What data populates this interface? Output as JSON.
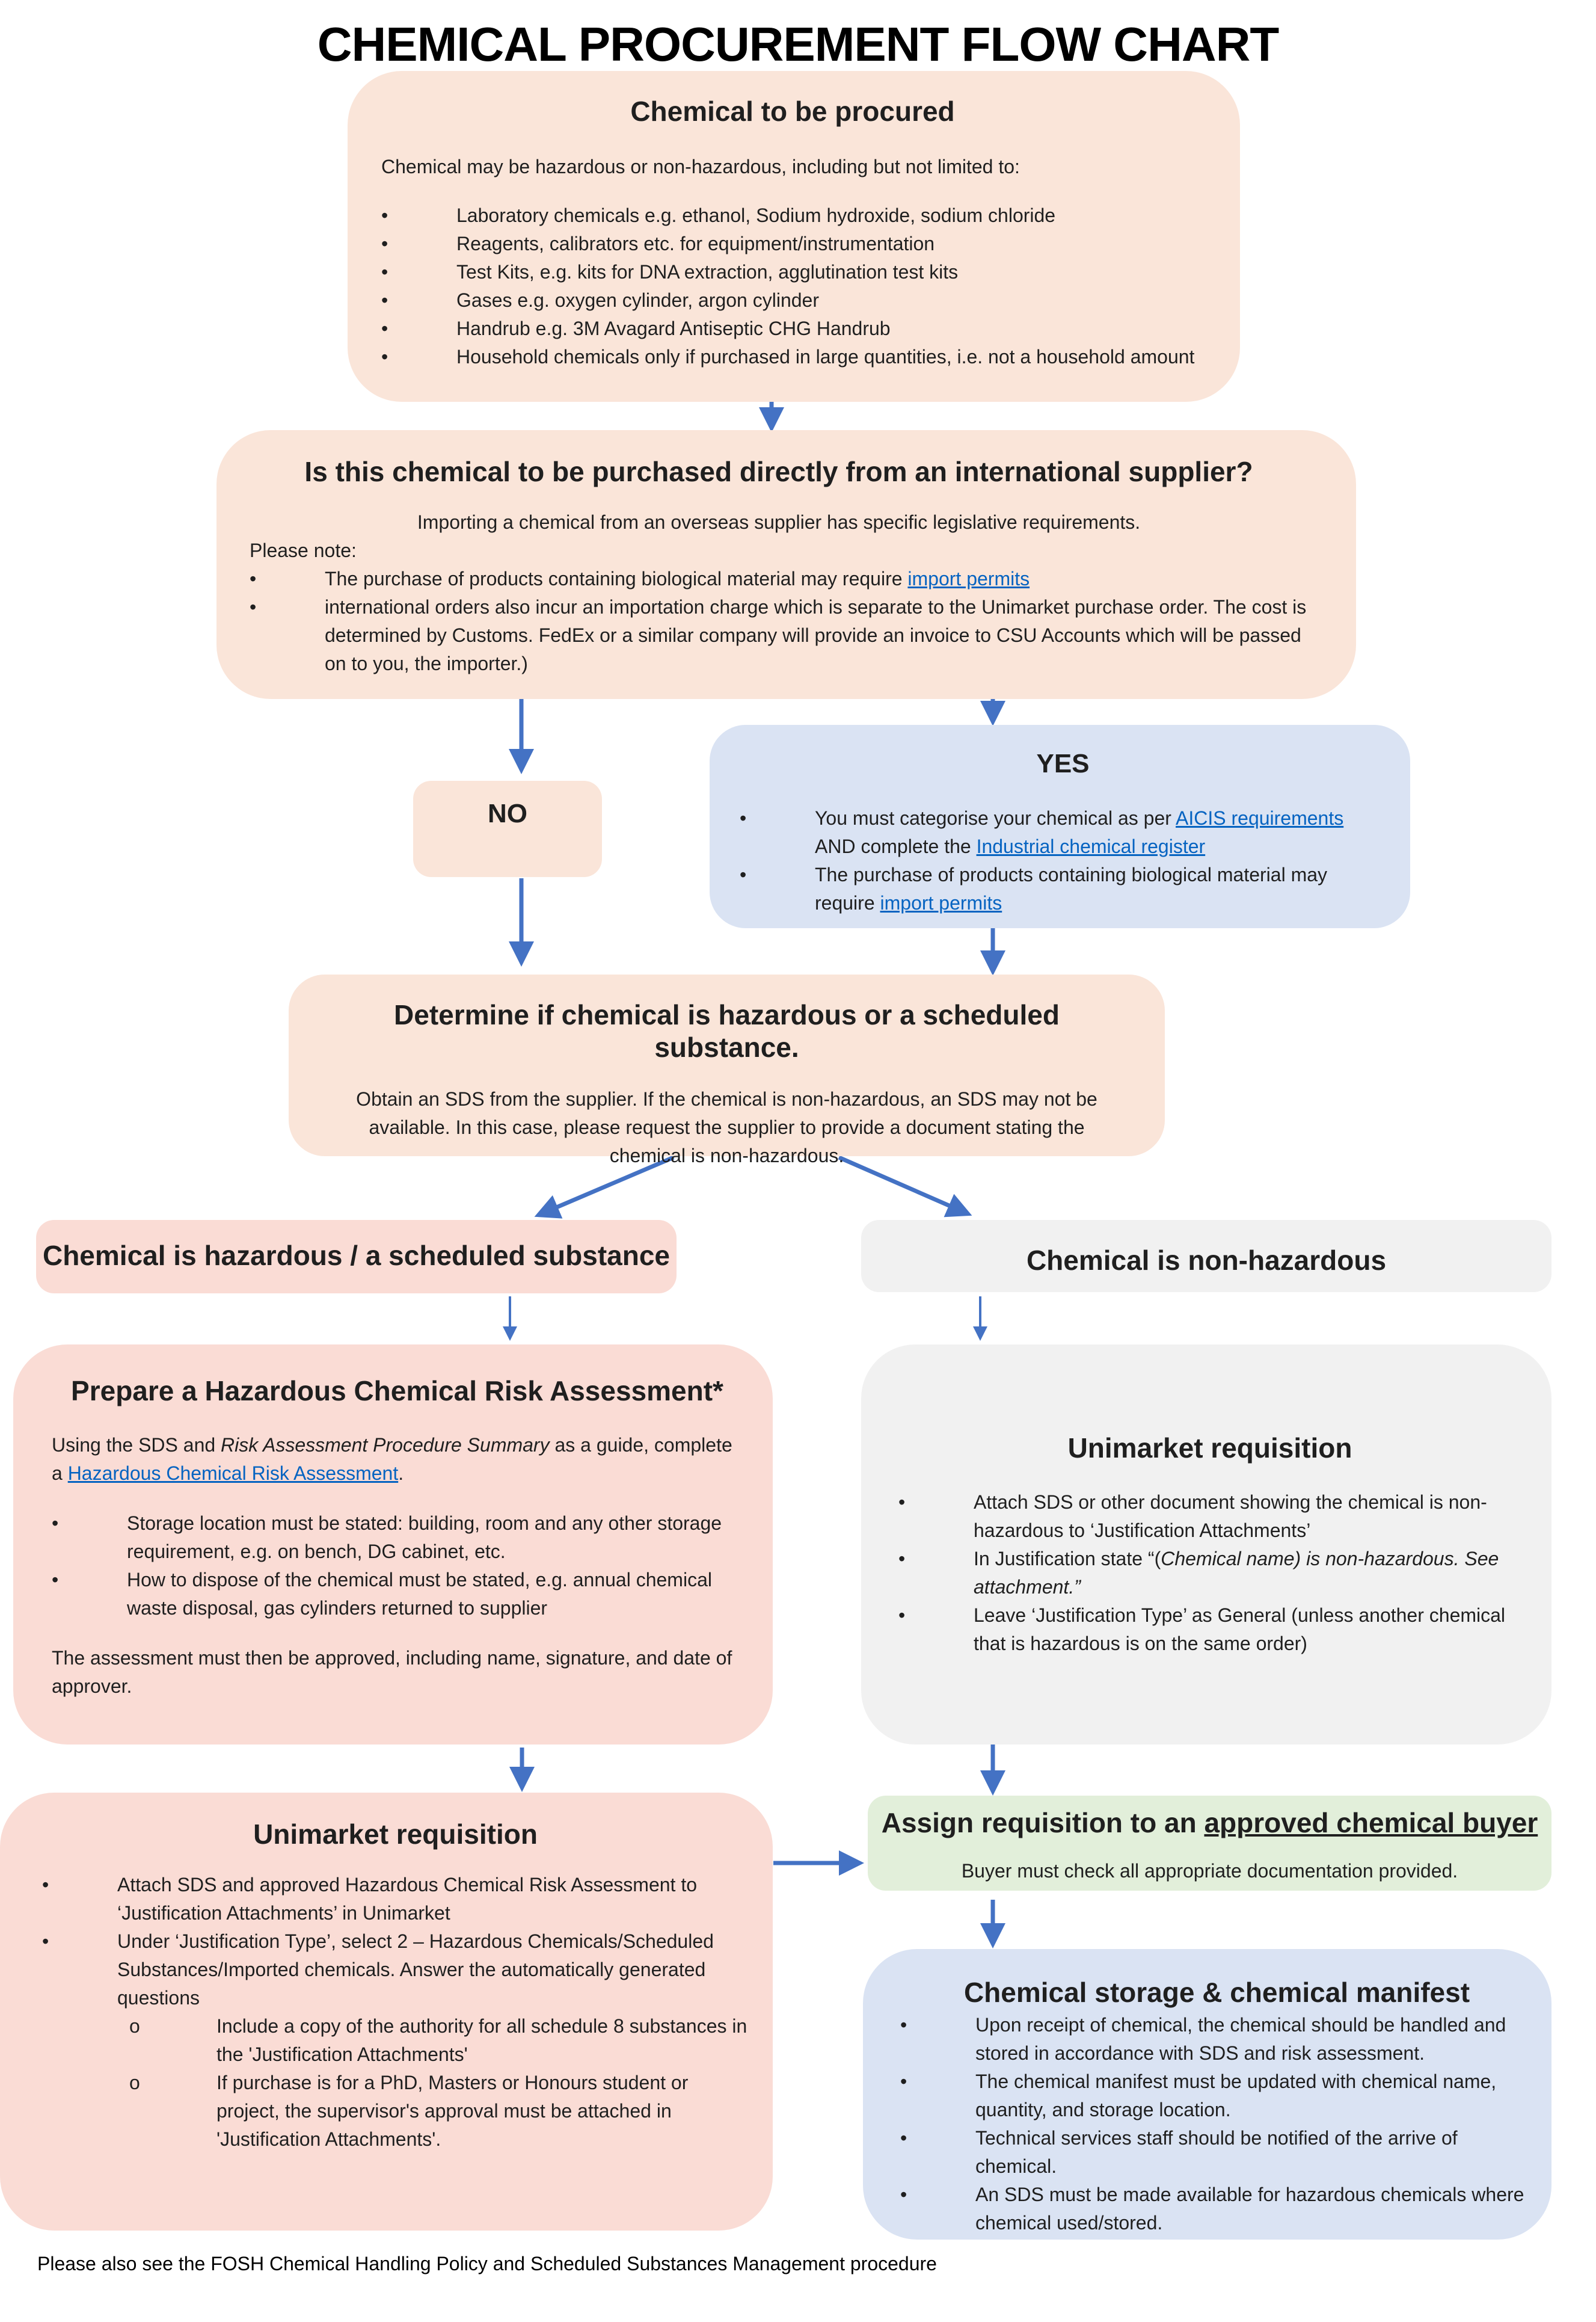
{
  "title": "CHEMICAL PROCUREMENT FLOW CHART",
  "colors": {
    "arrow": "#4472c4",
    "peach": "#fae5d9",
    "pink": "#fadcd5",
    "blue": "#dae3f3",
    "grey": "#f1f1f1",
    "green": "#e2efda",
    "link": "#0563c1"
  },
  "procured": {
    "heading": "Chemical to be procured",
    "intro": "Chemical may be hazardous or non-hazardous, including but not limited to:",
    "items": [
      "Laboratory chemicals e.g. ethanol, Sodium hydroxide, sodium chloride",
      "Reagents, calibrators etc. for equipment/instrumentation",
      "Test Kits, e.g. kits for DNA extraction, agglutination test kits",
      "Gases e.g. oxygen cylinder, argon cylinder",
      "Handrub e.g. 3M Avagard Antiseptic CHG Handrub",
      "Household chemicals only if purchased in large quantities, i.e. not a household amount"
    ]
  },
  "international": {
    "heading": "Is this chemical to be purchased directly from an international supplier?",
    "intro": "Importing a chemical from an overseas supplier has specific  legislative requirements.",
    "note_label": "Please note:",
    "item1_text": "The purchase of  products containing biological material may require ",
    "item1_link": "import permits",
    "item2_text": " international orders also incur an importation charge which is separate to the Unimarket purchase order. The cost is determined by Customs. FedEx or a similar company will provide an invoice to CSU Accounts which will be passed on to you, the importer.)"
  },
  "no_box": {
    "label": "NO"
  },
  "yes_box": {
    "heading": "YES",
    "item1_text": "You must categorise your chemical as per ",
    "item1_link": "AICIS requirements",
    "item1_text2": " AND  complete the ",
    "item1_link2": "Industrial chemical register",
    "item2_text": "The purchase of  products containing biological material may require ",
    "item2_link": "import permits"
  },
  "determine": {
    "heading": "Determine if chemical is hazardous or a scheduled substance.",
    "body": "Obtain an SDS from the supplier. If the chemical is non-hazardous, an SDS may not be available. In this case, please request the supplier to provide a document stating the chemical is non-hazardous."
  },
  "hazardous_label": "Chemical is hazardous / a scheduled substance",
  "nonhazardous_label": "Chemical is non-hazardous",
  "risk_assessment": {
    "heading": "Prepare a Hazardous Chemical Risk Assessment*",
    "intro_1": "Using the SDS and ",
    "intro_italic": "Risk Assessment Procedure Summary",
    "intro_2": "  as a guide, complete a ",
    "intro_link": "Hazardous Chemical Risk Assessment",
    "intro_3": ".",
    "items": [
      "Storage location must be stated: building, room and any other storage requirement, e.g. on bench, DG cabinet, etc.",
      "How to dispose of the chemical must be stated, e.g. annual chemical waste disposal, gas cylinders returned to supplier"
    ],
    "closing": "The assessment must then be approved, including name, signature, and date of approver."
  },
  "unimarket_nonhaz": {
    "heading": "Unimarket requisition",
    "item1": "Attach SDS or other document showing the chemical is non-hazardous to ‘Justification Attachments’",
    "item2_text": "In Justification state “(",
    "item2_italic": "Chemical name) is non-hazardous. See attachment.”",
    "item3": "Leave ‘Justification Type’ as General (unless another chemical that is hazardous is on the same order)"
  },
  "unimarket_haz": {
    "heading": "Unimarket requisition",
    "items": [
      "Attach SDS and approved Hazardous Chemical Risk Assessment to ‘Justification Attachments’ in Unimarket",
      "Under ‘Justification Type’, select 2 – Hazardous Chemicals/Scheduled Substances/Imported chemicals. Answer the automatically generated questions"
    ],
    "subitems": [
      "Include a copy of the authority for all schedule 8 substances in the 'Justification Attachments'",
      "If purchase is for a PhD, Masters or Honours student or project, the supervisor's approval must be attached in 'Justification Attachments'."
    ]
  },
  "assign": {
    "heading_text": "Assign requisition to an ",
    "heading_underlined": "approved chemical buyer",
    "body": "Buyer must check all appropriate documentation provided."
  },
  "storage": {
    "heading": "Chemical storage & chemical manifest",
    "items": [
      "Upon receipt of chemical, the chemical should be handled and stored in accordance with SDS and risk assessment.",
      " The chemical manifest must be updated with chemical name, quantity, and storage location.",
      "Technical services staff should be notified of the arrive of chemical.",
      "An SDS  must be made available for hazardous chemicals  where chemical used/stored."
    ]
  },
  "footer": "Please also see the FOSH Chemical Handling Policy and  Scheduled Substances Management procedure"
}
